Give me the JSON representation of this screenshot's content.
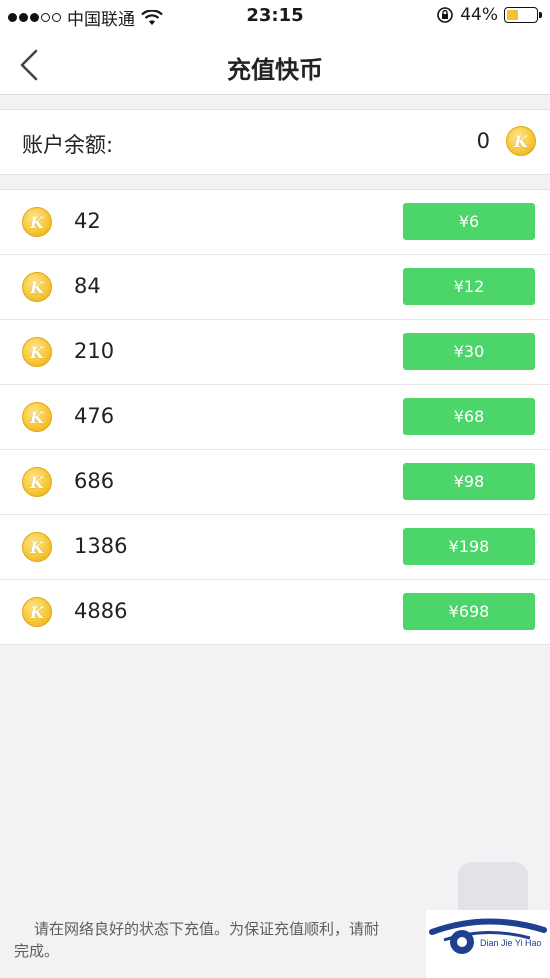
{
  "status_bar": {
    "carrier": "中国联通",
    "time": "23:15",
    "battery_percent": "44%",
    "battery_level": 0.44,
    "signal_bars": 3,
    "icons": [
      "signal-dots-icon",
      "wifi-icon",
      "rotation-lock-icon",
      "battery-icon"
    ]
  },
  "nav": {
    "title": "充值快币",
    "back_icon": "chevron-left-icon"
  },
  "balance": {
    "label": "账户余额:",
    "value": "0",
    "coin_icon": "kuaibi-coin-icon",
    "coin_letter": "K"
  },
  "packages": [
    {
      "coins": "42",
      "price": "¥6"
    },
    {
      "coins": "84",
      "price": "¥12"
    },
    {
      "coins": "210",
      "price": "¥30"
    },
    {
      "coins": "476",
      "price": "¥68"
    },
    {
      "coins": "686",
      "price": "¥98"
    },
    {
      "coins": "1386",
      "price": "¥198"
    },
    {
      "coins": "4886",
      "price": "¥698"
    }
  ],
  "footer": {
    "line1": "请在网络良好的状态下充值。为保证充值顺利，请耐",
    "line2": "完成。"
  },
  "watermark": {
    "text": "Dian Jie Yi Hao"
  },
  "colors": {
    "accent_green": "#4cd569",
    "coin_gold": "#f6c83a",
    "background": "#f2f2f4"
  }
}
